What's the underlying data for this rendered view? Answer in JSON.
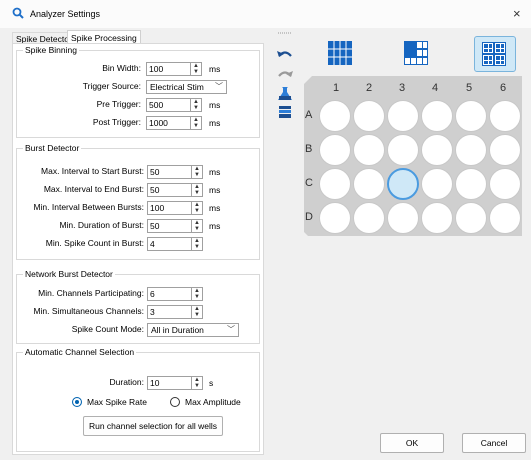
{
  "window": {
    "title": "Analyzer Settings",
    "close_icon": "×"
  },
  "tabs": [
    {
      "label": "Spike Detector",
      "active": false
    },
    {
      "label": "Spike Processing",
      "active": true
    }
  ],
  "spike_binning": {
    "title": "Spike Binning",
    "bin_width": {
      "label": "Bin Width:",
      "value": "100",
      "unit": "ms"
    },
    "trigger_source": {
      "label": "Trigger Source:",
      "value": "Electrical Stim"
    },
    "pre_trigger": {
      "label": "Pre Trigger:",
      "value": "500",
      "unit": "ms"
    },
    "post_trigger": {
      "label": "Post Trigger:",
      "value": "1000",
      "unit": "ms"
    }
  },
  "burst_detector": {
    "title": "Burst Detector",
    "max_interval_start": {
      "label": "Max. Interval to Start Burst:",
      "value": "50",
      "unit": "ms"
    },
    "max_interval_end": {
      "label": "Max. Interval to End Burst:",
      "value": "50",
      "unit": "ms"
    },
    "min_interval_between": {
      "label": "Min. Interval Between Bursts:",
      "value": "100",
      "unit": "ms"
    },
    "min_duration": {
      "label": "Min. Duration of Burst:",
      "value": "50",
      "unit": "ms"
    },
    "min_spike_count": {
      "label": "Min. Spike Count in Burst:",
      "value": "4"
    }
  },
  "network_burst_detector": {
    "title": "Network Burst Detector",
    "min_channels": {
      "label": "Min. Channels Participating:",
      "value": "6"
    },
    "min_simultaneous": {
      "label": "Min. Simultaneous Channels:",
      "value": "3"
    },
    "spike_count_mode": {
      "label": "Spike Count Mode:",
      "value": "All in Duration"
    }
  },
  "automatic_channel_selection": {
    "title": "Automatic Channel Selection",
    "duration": {
      "label": "Duration:",
      "value": "10",
      "unit": "s"
    },
    "radio_max_spike_rate": {
      "label": "Max Spike Rate",
      "checked": true
    },
    "radio_max_amplitude": {
      "label": "Max Amplitude",
      "checked": false
    },
    "run_button": "Run channel selection for all wells"
  },
  "toolstrip": {
    "icons": [
      "undo-icon",
      "redo-icon",
      "flask-icon",
      "layers-icon"
    ]
  },
  "plate_layouts": [
    {
      "name": "12-well-layout-icon",
      "selected": false
    },
    {
      "name": "24-well-layout-icon",
      "selected": false
    },
    {
      "name": "48-well-layout-icon",
      "selected": true
    }
  ],
  "plate": {
    "columns": [
      "1",
      "2",
      "3",
      "4",
      "5",
      "6"
    ],
    "rows": [
      "A",
      "B",
      "C",
      "D"
    ],
    "selected_well": "C3"
  },
  "footer": {
    "ok": "OK",
    "cancel": "Cancel"
  },
  "colors": {
    "accent": "#0063b1",
    "layout_blue": "#1565c0",
    "selected_well": "#cfe8f7",
    "plate_bg": "#cfcfcf"
  }
}
